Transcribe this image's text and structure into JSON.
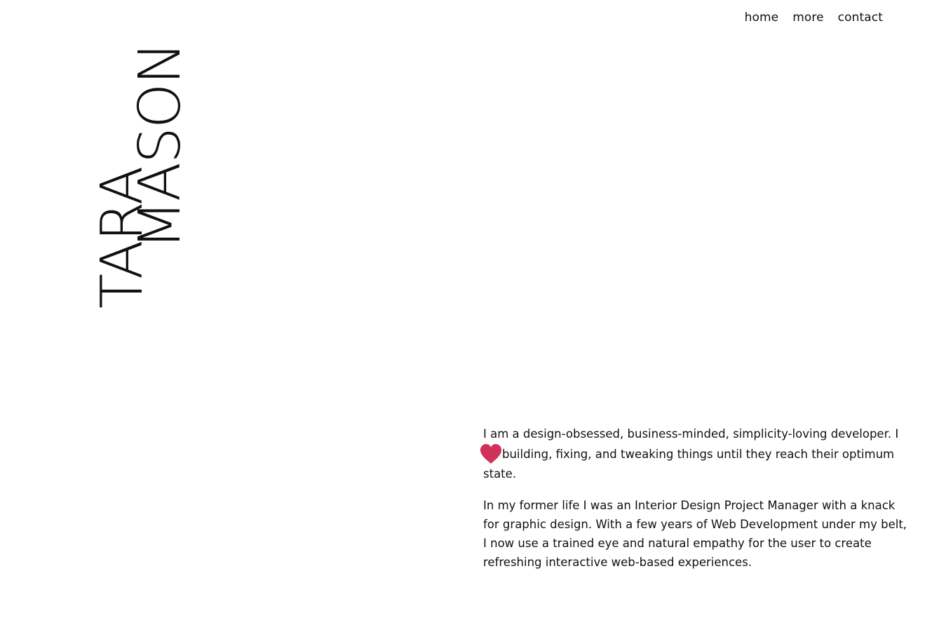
{
  "nav": {
    "items": [
      {
        "label": "home"
      },
      {
        "label": "more"
      },
      {
        "label": "contact"
      }
    ]
  },
  "logo": {
    "first_name": "TARA",
    "last_name": "MASON"
  },
  "about": {
    "p1_before": "I am a design-obsessed, business-minded, simplicity-loving developer. I ",
    "heart_icon": "heart-icon",
    "p1_after": "building, fixing, and tweaking things until they reach their optimum state.",
    "p2": "In my former life I was an Interior Design Project Manager with a knack for graphic design. With a few years of Web Development under my belt, I now use a trained eye and natural empathy for the user to create refreshing interactive web-based experiences."
  },
  "colors": {
    "text": "#111111",
    "background": "#ffffff",
    "heart": "#d0305a"
  }
}
